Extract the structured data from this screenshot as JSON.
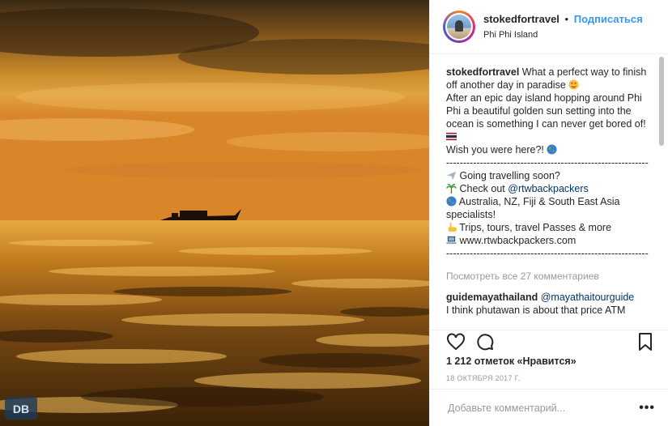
{
  "header": {
    "username": "stokedfortravel",
    "separator": "•",
    "follow_label": "Подписаться",
    "location": "Phi Phi Island"
  },
  "caption": {
    "username": "stokedfortravel",
    "text_1": "What a perfect way to finish off another day in paradise",
    "text_2": "After an epic day island hopping around Phi Phi a beautiful golden sun setting into the ocean is something I can never get bored of!",
    "text_3": "Wish you were here?!",
    "divider_1": "------------------------------------------------------------",
    "line_going": "Going travelling soon?",
    "line_checkout": "Check out",
    "mention": "@rtwbackpackers",
    "line_regions": "Australia, NZ, Fiji & South East Asia specialists!",
    "line_trips": "Trips, tours, travel Passes & more",
    "line_web": "www.rtwbackpackers.com",
    "divider_2": "------------------------------------------------------------"
  },
  "view_all": "Посмотреть все 27 комментариев",
  "comment": {
    "username": "guidemayathailand",
    "mention": "@mayathaitourguide",
    "text": "I think phutawan is about that price ATM"
  },
  "icons": {
    "like": "heart-icon",
    "comment": "comment-icon",
    "save": "bookmark-icon",
    "more": "more-options-icon"
  },
  "likes": "1 212 отметок «Нравится»",
  "date": "18 ОКТЯБРЯ 2017 Г.",
  "add_comment": {
    "placeholder": "Добавьте комментарий...",
    "more_label": "•••"
  },
  "colors": {
    "follow": "#3897f0",
    "link": "#003569",
    "muted": "#999999"
  }
}
